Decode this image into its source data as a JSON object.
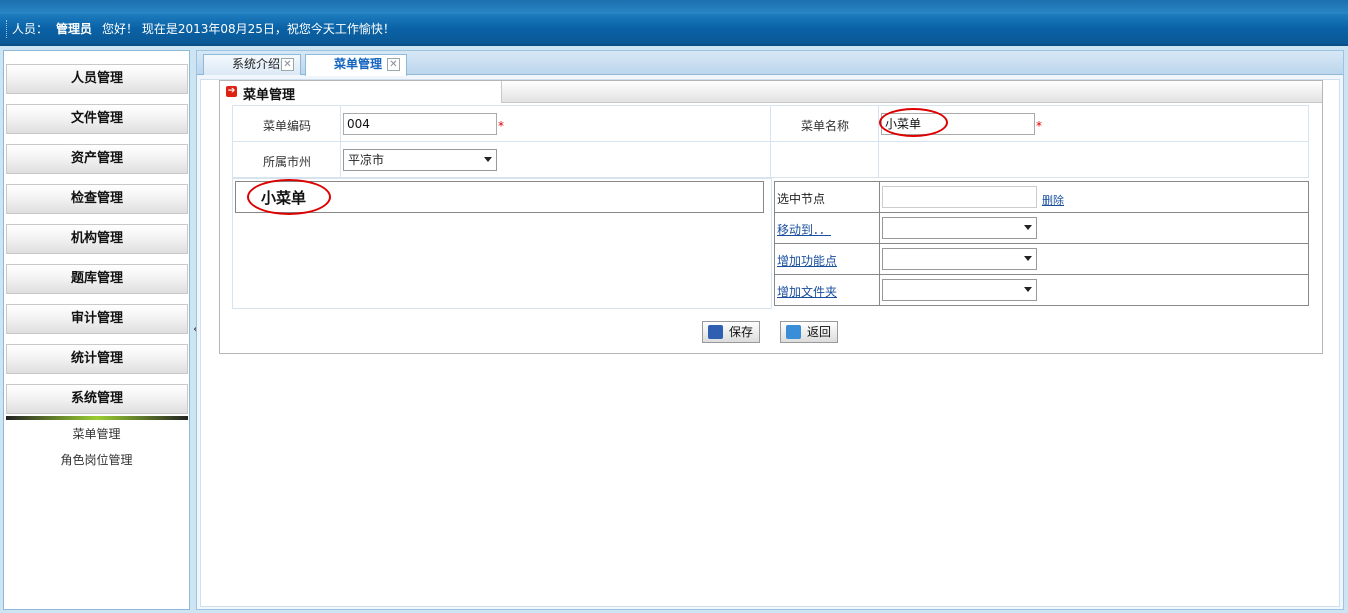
{
  "header": {
    "user_label": "人员：",
    "user_name": "管理员",
    "greeting": "您好！ 现在是2013年08月25日，祝您今天工作愉快！"
  },
  "sidebar": {
    "items": [
      {
        "label": "人员管理"
      },
      {
        "label": "文件管理"
      },
      {
        "label": "资产管理"
      },
      {
        "label": "检查管理"
      },
      {
        "label": "机构管理"
      },
      {
        "label": "题库管理"
      },
      {
        "label": "审计管理"
      },
      {
        "label": "统计管理"
      },
      {
        "label": "系统管理"
      }
    ],
    "sub_items": [
      {
        "label": "菜单管理"
      },
      {
        "label": "角色岗位管理"
      }
    ],
    "collapse_glyph": "«"
  },
  "tabs": [
    {
      "label": "系统介绍",
      "close": "✕"
    },
    {
      "label": "菜单管理",
      "close": "✕"
    }
  ],
  "panel": {
    "title": "菜单管理",
    "menu_code_label": "菜单编码",
    "menu_code_value": "004",
    "menu_name_label": "菜单名称",
    "menu_name_value": "小菜单",
    "city_label": "所属市州",
    "city_value": "平凉市",
    "required_mark": "*",
    "tree_node": "小菜单",
    "selected_node_label": "选中节点",
    "delete_link": "删除",
    "move_to_link": "移动到．．",
    "add_function_link": "增加功能点",
    "add_folder_link": "增加文件夹",
    "save_button": "保存",
    "back_button": "返回"
  },
  "colors": {
    "header_blue": "#0a62a5",
    "required_red": "#dd0000",
    "link_blue": "#1a4fa0"
  }
}
